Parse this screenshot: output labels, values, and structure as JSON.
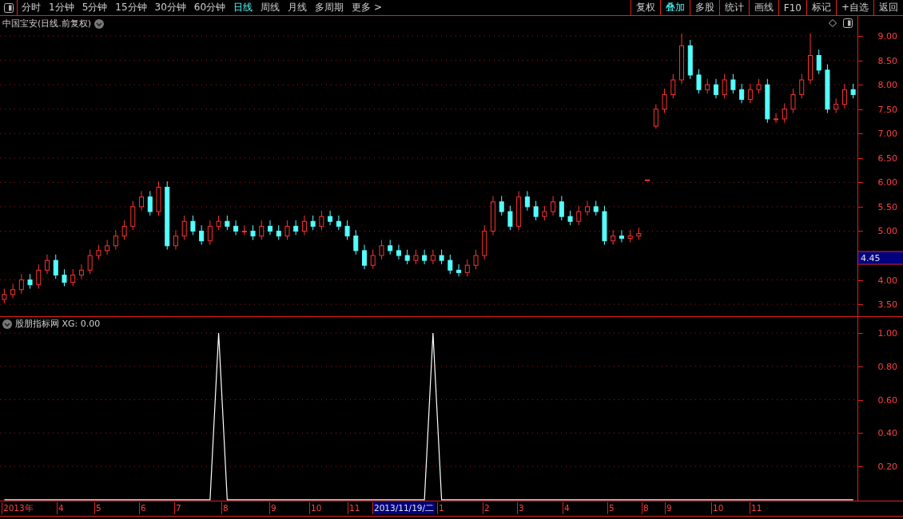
{
  "toolbar": {
    "periods": [
      {
        "label": "分时",
        "selected": false
      },
      {
        "label": "1分钟",
        "selected": false
      },
      {
        "label": "5分钟",
        "selected": false
      },
      {
        "label": "15分钟",
        "selected": false
      },
      {
        "label": "30分钟",
        "selected": false
      },
      {
        "label": "60分钟",
        "selected": false
      },
      {
        "label": "日线",
        "selected": true
      },
      {
        "label": "周线",
        "selected": false
      },
      {
        "label": "月线",
        "selected": false
      },
      {
        "label": "多周期",
        "selected": false
      },
      {
        "label": "更多 >",
        "selected": false
      }
    ],
    "actions": [
      {
        "label": "复权",
        "selected": false
      },
      {
        "label": "叠加",
        "selected": true
      },
      {
        "label": "多股",
        "selected": false
      },
      {
        "label": "统计",
        "selected": false
      },
      {
        "label": "画线",
        "selected": false
      },
      {
        "label": "F10",
        "selected": false
      },
      {
        "label": "标记",
        "selected": false
      },
      {
        "label": "+自选",
        "selected": false
      },
      {
        "label": "返回",
        "selected": false
      }
    ]
  },
  "price_panel": {
    "title": "中国宝安(日线.前复权)",
    "last_price": "4.45",
    "chart_data": {
      "type": "candlestick",
      "grid": true,
      "ylim": [
        3.24,
        9.41
      ],
      "yticks": [
        {
          "value": 3.5,
          "label": "3.50"
        },
        {
          "value": 4,
          "label": "4.00"
        },
        {
          "value": 5,
          "label": "5.00"
        },
        {
          "value": 5.5,
          "label": "5.50"
        },
        {
          "value": 6,
          "label": "6.00"
        },
        {
          "value": 6.5,
          "label": "6.50"
        },
        {
          "value": 7,
          "label": "7.00"
        },
        {
          "value": 7.5,
          "label": "7.50"
        },
        {
          "value": 8,
          "label": "8.00"
        },
        {
          "value": 8.5,
          "label": "8.50"
        },
        {
          "value": 9,
          "label": "9.00"
        }
      ],
      "ohlc": [
        [
          3.6,
          3.82,
          3.52,
          3.7
        ],
        [
          3.7,
          3.92,
          3.62,
          3.8
        ],
        [
          3.8,
          4.12,
          3.72,
          4.0
        ],
        [
          4.0,
          4.12,
          3.82,
          3.9
        ],
        [
          3.9,
          4.32,
          3.82,
          4.2
        ],
        [
          4.2,
          4.52,
          4.12,
          4.4
        ],
        [
          4.4,
          4.52,
          4.02,
          4.1
        ],
        [
          4.1,
          4.22,
          3.87,
          3.95
        ],
        [
          3.95,
          4.22,
          3.87,
          4.1
        ],
        [
          4.1,
          4.32,
          4.02,
          4.2
        ],
        [
          4.2,
          4.62,
          4.12,
          4.5
        ],
        [
          4.5,
          4.72,
          4.42,
          4.6
        ],
        [
          4.6,
          4.82,
          4.52,
          4.7
        ],
        [
          4.7,
          5.02,
          4.62,
          4.9
        ],
        [
          4.9,
          5.22,
          4.82,
          5.1
        ],
        [
          5.1,
          5.62,
          5.02,
          5.5
        ],
        [
          5.5,
          5.82,
          5.42,
          5.7
        ],
        [
          5.7,
          5.82,
          5.32,
          5.4
        ],
        [
          5.4,
          6.02,
          5.32,
          5.9
        ],
        [
          5.9,
          6.02,
          4.62,
          4.7
        ],
        [
          4.7,
          5.02,
          4.62,
          4.9
        ],
        [
          4.9,
          5.32,
          4.82,
          5.2
        ],
        [
          5.2,
          5.32,
          4.92,
          5.0
        ],
        [
          5.0,
          5.12,
          4.72,
          4.8
        ],
        [
          4.8,
          5.22,
          4.72,
          5.1
        ],
        [
          5.1,
          5.32,
          5.02,
          5.2
        ],
        [
          5.2,
          5.32,
          5.02,
          5.1
        ],
        [
          5.1,
          5.22,
          4.92,
          5.0
        ],
        [
          5.0,
          5.12,
          4.92,
          5.0
        ],
        [
          5.0,
          5.12,
          4.82,
          4.9
        ],
        [
          4.9,
          5.22,
          4.82,
          5.1
        ],
        [
          5.1,
          5.22,
          4.92,
          5.0
        ],
        [
          5.0,
          5.12,
          4.82,
          4.9
        ],
        [
          4.9,
          5.22,
          4.82,
          5.1
        ],
        [
          5.1,
          5.22,
          4.92,
          5.0
        ],
        [
          5.0,
          5.32,
          4.92,
          5.2
        ],
        [
          5.2,
          5.32,
          5.02,
          5.1
        ],
        [
          5.1,
          5.42,
          5.02,
          5.3
        ],
        [
          5.3,
          5.42,
          5.12,
          5.2
        ],
        [
          5.2,
          5.32,
          5.02,
          5.1
        ],
        [
          5.1,
          5.22,
          4.82,
          4.9
        ],
        [
          4.9,
          5.02,
          4.52,
          4.6
        ],
        [
          4.6,
          4.72,
          4.22,
          4.3
        ],
        [
          4.3,
          4.62,
          4.22,
          4.5
        ],
        [
          4.5,
          4.82,
          4.42,
          4.7
        ],
        [
          4.7,
          4.82,
          4.52,
          4.6
        ],
        [
          4.6,
          4.72,
          4.42,
          4.5
        ],
        [
          4.5,
          4.62,
          4.32,
          4.4
        ],
        [
          4.4,
          4.62,
          4.32,
          4.5
        ],
        [
          4.5,
          4.62,
          4.32,
          4.4
        ],
        [
          4.4,
          4.62,
          4.32,
          4.5
        ],
        [
          4.5,
          4.62,
          4.32,
          4.4
        ],
        [
          4.4,
          4.52,
          4.12,
          4.2
        ],
        [
          4.2,
          4.32,
          4.07,
          4.15
        ],
        [
          4.15,
          4.42,
          4.07,
          4.3
        ],
        [
          4.3,
          4.62,
          4.22,
          4.5
        ],
        [
          4.5,
          5.12,
          4.42,
          5.0
        ],
        [
          5.0,
          5.72,
          4.92,
          5.6
        ],
        [
          5.6,
          5.72,
          5.32,
          5.4
        ],
        [
          5.4,
          5.52,
          5.02,
          5.1
        ],
        [
          5.1,
          5.82,
          5.02,
          5.7
        ],
        [
          5.7,
          5.82,
          5.42,
          5.5
        ],
        [
          5.5,
          5.62,
          5.22,
          5.3
        ],
        [
          5.3,
          5.52,
          5.22,
          5.4
        ],
        [
          5.4,
          5.72,
          5.32,
          5.6
        ],
        [
          5.6,
          5.72,
          5.22,
          5.3
        ],
        [
          5.3,
          5.42,
          5.12,
          5.2
        ],
        [
          5.2,
          5.52,
          5.12,
          5.4
        ],
        [
          5.4,
          5.62,
          5.32,
          5.5
        ],
        [
          5.5,
          5.62,
          5.32,
          5.4
        ],
        [
          5.4,
          5.52,
          4.72,
          4.8
        ],
        [
          4.8,
          5.02,
          4.72,
          4.9
        ],
        [
          4.9,
          5.02,
          4.77,
          4.85
        ],
        [
          4.85,
          5.02,
          4.77,
          4.9
        ],
        [
          4.9,
          5.07,
          4.82,
          4.95
        ],
        [
          6.05,
          6.05,
          6.05,
          6.05
        ],
        [
          7.15,
          7.6,
          7.1,
          7.5
        ],
        [
          7.5,
          7.92,
          7.42,
          7.8
        ],
        [
          7.8,
          8.22,
          7.72,
          8.1
        ],
        [
          8.1,
          9.05,
          8.02,
          8.8
        ],
        [
          8.8,
          8.92,
          8.12,
          8.2
        ],
        [
          8.2,
          8.32,
          7.82,
          7.9
        ],
        [
          7.9,
          8.12,
          7.82,
          8.0
        ],
        [
          8.0,
          8.12,
          7.72,
          7.8
        ],
        [
          7.8,
          8.22,
          7.72,
          8.1
        ],
        [
          8.1,
          8.22,
          7.82,
          7.9
        ],
        [
          7.9,
          8.02,
          7.62,
          7.7
        ],
        [
          7.7,
          8.02,
          7.62,
          7.9
        ],
        [
          7.9,
          8.12,
          7.82,
          8.0
        ],
        [
          8.0,
          8.12,
          7.22,
          7.3
        ],
        [
          7.3,
          7.42,
          7.22,
          7.3
        ],
        [
          7.3,
          7.62,
          7.22,
          7.5
        ],
        [
          7.5,
          7.92,
          7.42,
          7.8
        ],
        [
          7.8,
          8.22,
          7.72,
          8.1
        ],
        [
          8.1,
          9.05,
          8.02,
          8.6
        ],
        [
          8.6,
          8.72,
          8.22,
          8.3
        ],
        [
          8.3,
          8.42,
          7.42,
          7.5
        ],
        [
          7.5,
          7.72,
          7.42,
          7.6
        ],
        [
          7.6,
          8.02,
          7.52,
          7.9
        ],
        [
          7.9,
          8.02,
          7.72,
          7.8
        ]
      ]
    }
  },
  "indicator_panel": {
    "title": "股朋指标网 XG: 0.00",
    "chart_data": {
      "type": "line",
      "grid": true,
      "ylim": [
        -0.01,
        1.096
      ],
      "yticks": [
        {
          "value": 0.2,
          "label": "0.20"
        },
        {
          "value": 0.4,
          "label": "0.40"
        },
        {
          "value": 0.6,
          "label": "0.60"
        },
        {
          "value": 0.8,
          "label": "0.80"
        },
        {
          "value": 1,
          "label": "1.00"
        }
      ],
      "values": [
        0,
        0,
        0,
        0,
        0,
        0,
        0,
        0,
        0,
        0,
        0,
        0,
        0,
        0,
        0,
        0,
        0,
        0,
        0,
        0,
        0,
        0,
        0,
        0,
        0,
        1,
        0,
        0,
        0,
        0,
        0,
        0,
        0,
        0,
        0,
        0,
        0,
        0,
        0,
        0,
        0,
        0,
        0,
        0,
        0,
        0,
        0,
        0,
        0,
        0,
        1,
        0,
        0,
        0,
        0,
        0,
        0,
        0,
        0,
        0,
        0,
        0,
        0,
        0,
        0,
        0,
        0,
        0,
        0,
        0,
        0,
        0,
        0,
        0,
        0,
        0,
        0,
        0,
        0,
        0,
        0,
        0,
        0,
        0,
        0,
        0,
        0,
        0,
        0,
        0,
        0,
        0,
        0,
        0,
        0,
        0,
        0,
        0,
        0,
        0
      ]
    }
  },
  "time_axis": {
    "ticks": [
      {
        "label": "2013年",
        "selected": false
      },
      {
        "label": "4",
        "selected": false
      },
      {
        "label": "5",
        "selected": false
      },
      {
        "label": "6",
        "selected": false
      },
      {
        "label": "7",
        "selected": false
      },
      {
        "label": "8",
        "selected": false
      },
      {
        "label": "9",
        "selected": false
      },
      {
        "label": "10",
        "selected": false
      },
      {
        "label": "11",
        "selected": false
      },
      {
        "label": "2013/11/19/二",
        "selected": true
      },
      {
        "label": "1",
        "selected": false
      },
      {
        "label": "2",
        "selected": false
      },
      {
        "label": "3",
        "selected": false
      },
      {
        "label": "4",
        "selected": false
      },
      {
        "label": "5",
        "selected": false
      },
      {
        "label": "8",
        "selected": false
      },
      {
        "label": "9",
        "selected": false
      },
      {
        "label": "10",
        "selected": false
      },
      {
        "label": "11",
        "selected": false
      }
    ]
  }
}
